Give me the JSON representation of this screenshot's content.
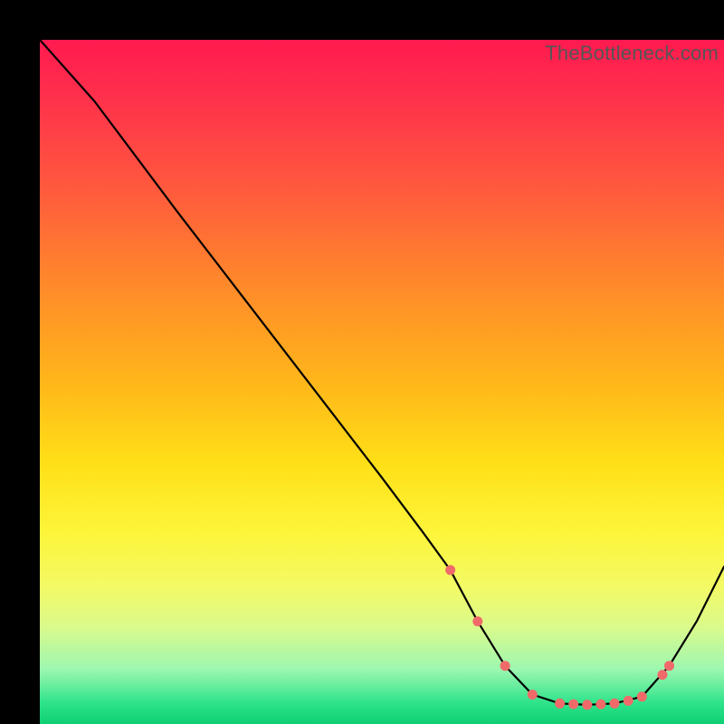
{
  "watermark": "TheBottleneck.com",
  "colors": {
    "curve": "#000000",
    "marker": "#f06a6a",
    "gradient_top": "#ff1a4f",
    "gradient_bottom": "#0fcf73"
  },
  "chart_data": {
    "type": "line",
    "title": "",
    "xlabel": "",
    "ylabel": "",
    "xlim": [
      0,
      100
    ],
    "ylim": [
      0,
      100
    ],
    "grid": false,
    "legend": false,
    "background": "vertical red-yellow-green gradient indicating bottleneck severity (red high, green low)",
    "series": [
      {
        "name": "bottleneck-curve",
        "x": [
          0,
          8,
          20,
          30,
          40,
          50,
          56,
          60,
          64,
          68,
          72,
          76,
          80,
          84,
          88,
          92,
          96,
          100
        ],
        "y": [
          100,
          91,
          75,
          62,
          49,
          36,
          28,
          22.5,
          15,
          8.5,
          4.3,
          3,
          2.8,
          3,
          4,
          8.5,
          15,
          23
        ]
      }
    ],
    "markers": {
      "name": "highlighted-points",
      "x": [
        60,
        64,
        68,
        72,
        76,
        78,
        80,
        82,
        84,
        86,
        88,
        91,
        92
      ],
      "y": [
        22.5,
        15,
        8.5,
        4.3,
        3,
        2.9,
        2.8,
        2.9,
        3,
        3.4,
        4,
        7.2,
        8.5
      ]
    }
  }
}
